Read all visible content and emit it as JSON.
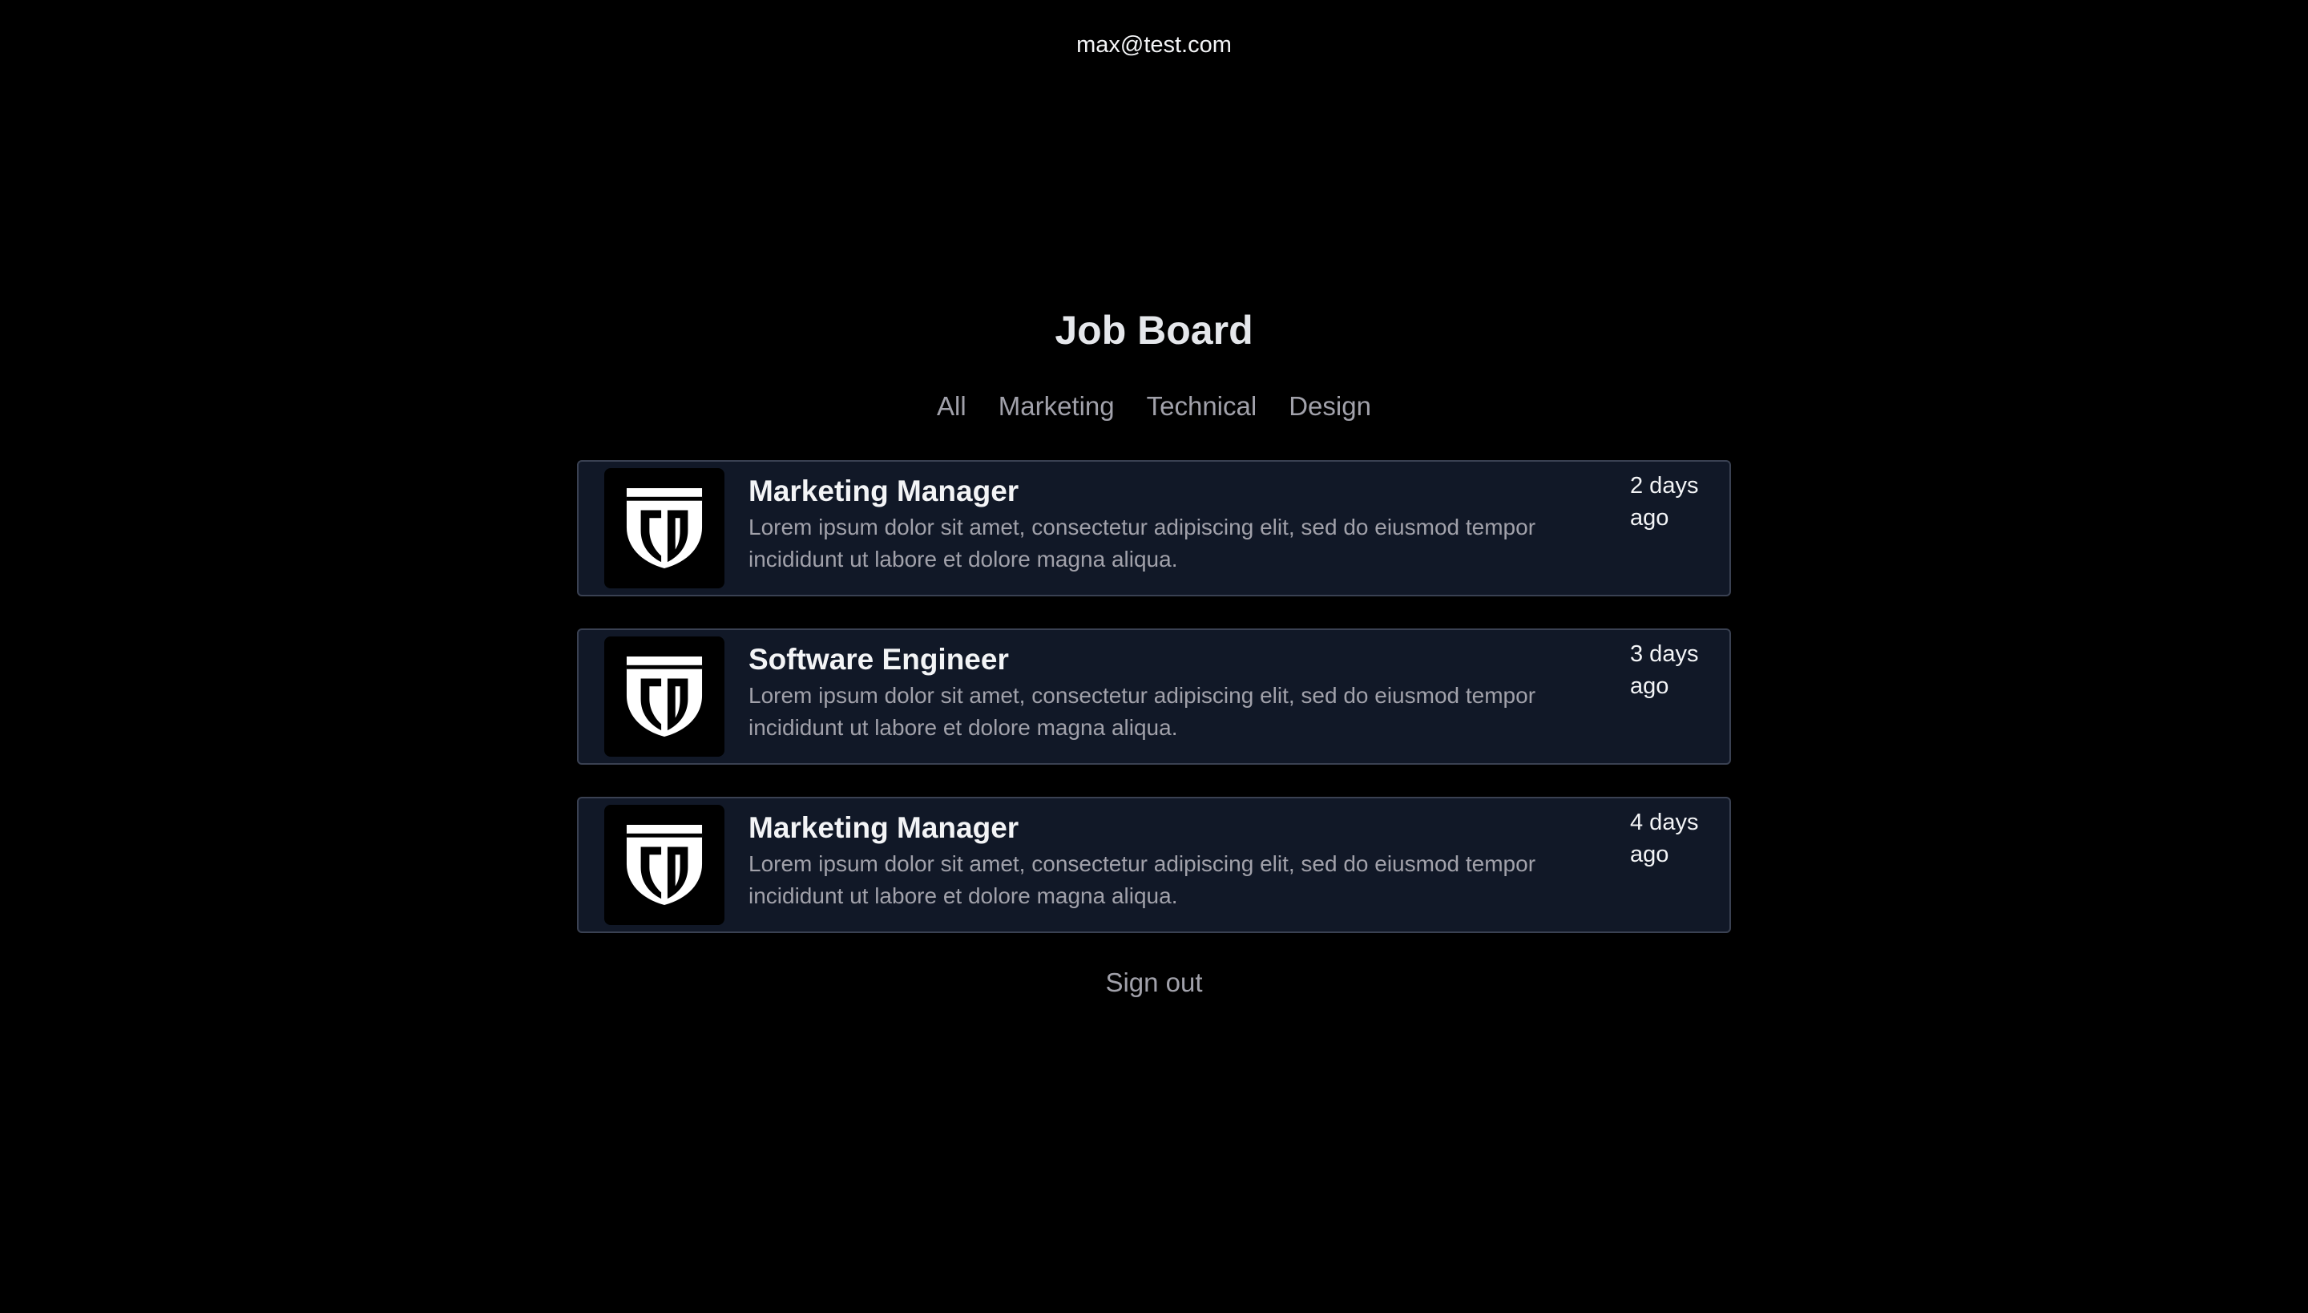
{
  "header": {
    "user_email": "max@test.com"
  },
  "main": {
    "title": "Job Board",
    "filters": [
      {
        "label": "All"
      },
      {
        "label": "Marketing"
      },
      {
        "label": "Technical"
      },
      {
        "label": "Design"
      }
    ],
    "jobs": [
      {
        "title": "Marketing Manager",
        "description": "Lorem ipsum dolor sit amet, consectetur adipiscing elit, sed do eiusmod tempor incididunt ut labore et dolore magna aliqua.",
        "posted": "2 days ago",
        "logo_icon": "cd-shield-logo"
      },
      {
        "title": "Software Engineer",
        "description": "Lorem ipsum dolor sit amet, consectetur adipiscing elit, sed do eiusmod tempor incididunt ut labore et dolore magna aliqua.",
        "posted": "3 days ago",
        "logo_icon": "cd-shield-logo"
      },
      {
        "title": "Marketing Manager",
        "description": "Lorem ipsum dolor sit amet, consectetur adipiscing elit, sed do eiusmod tempor incididunt ut labore et dolore magna aliqua.",
        "posted": "4 days ago",
        "logo_icon": "cd-shield-logo"
      }
    ],
    "signout_label": "Sign out"
  },
  "colors": {
    "background": "#000000",
    "card_background": "#111827",
    "card_border": "#3a4152",
    "muted_text": "#a1a1aa",
    "primary_text": "#f3f4f6"
  }
}
